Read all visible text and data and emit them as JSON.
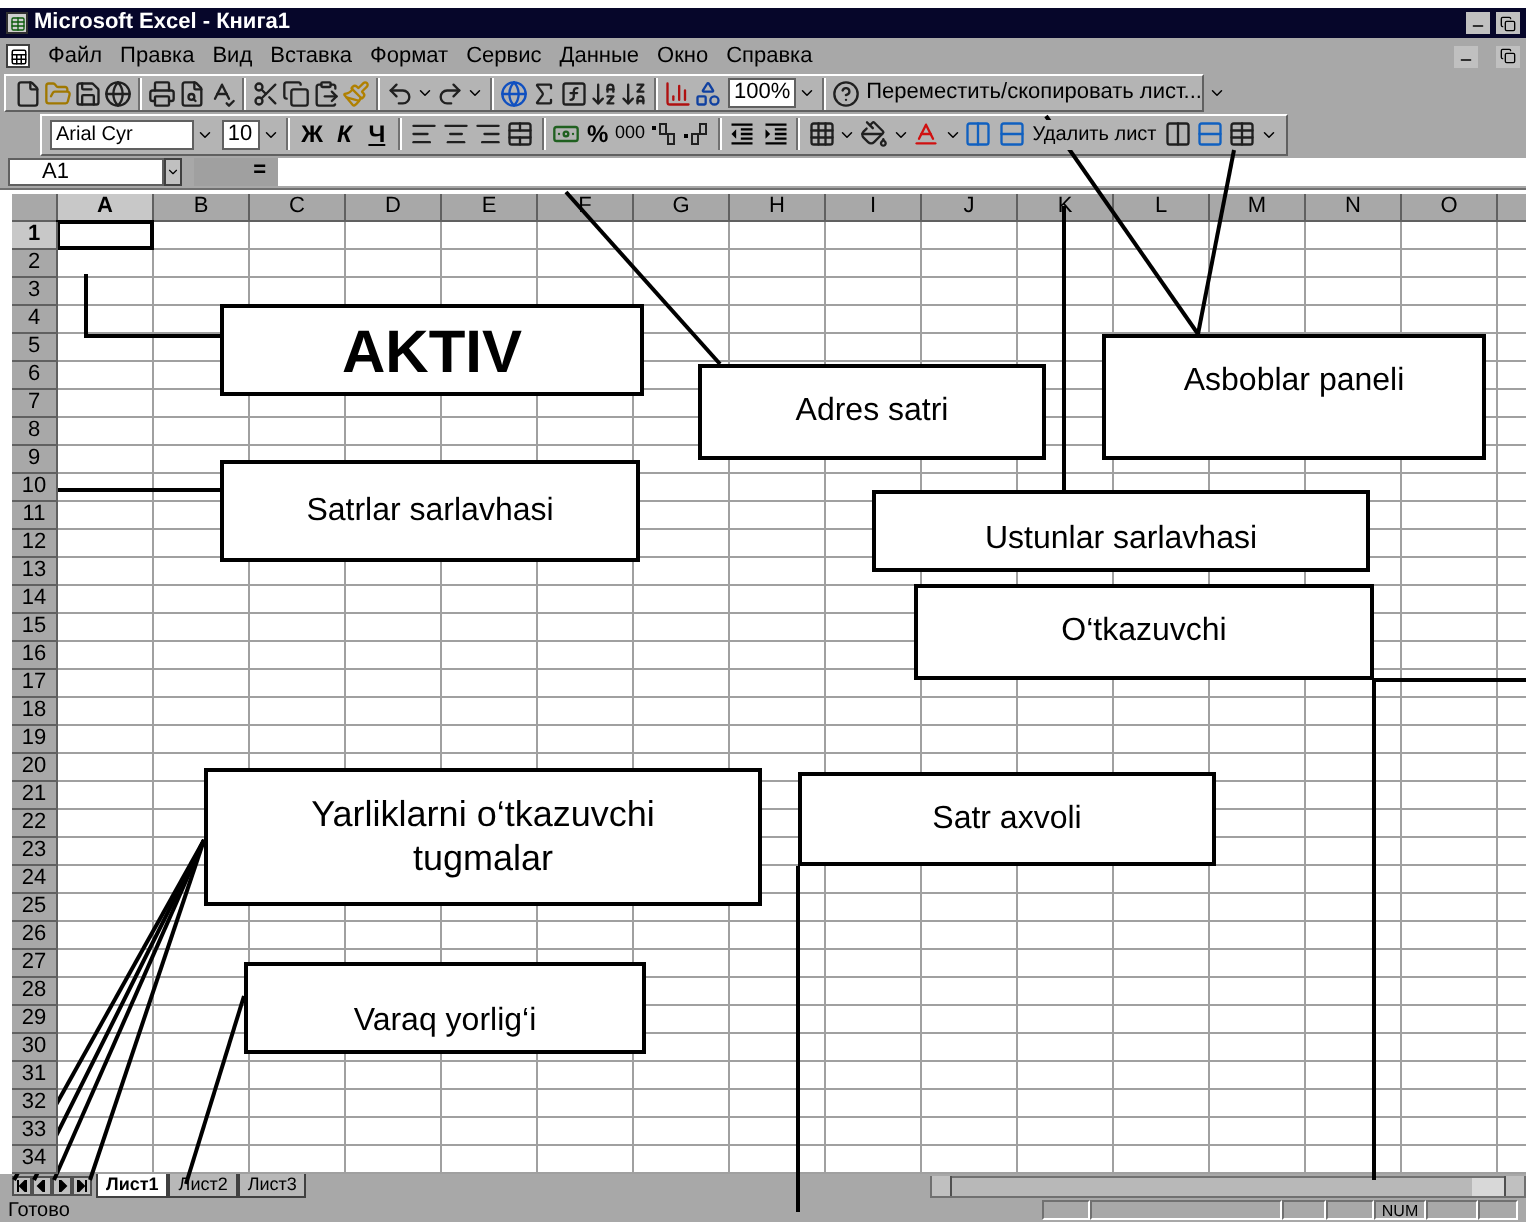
{
  "window": {
    "title": "Microsoft Excel - Книга1"
  },
  "menu": [
    "Файл",
    "Правка",
    "Вид",
    "Вставка",
    "Формат",
    "Сервис",
    "Данные",
    "Окно",
    "Справка"
  ],
  "standard_toolbar": {
    "zoom": "100%",
    "command": "Переместить/скопировать лист..."
  },
  "formatting_toolbar": {
    "font": "Arial Cyr",
    "size": "10",
    "styles": [
      "Ж",
      "К",
      "Ч"
    ],
    "percent": "%",
    "thousands": "000",
    "command": "Удалить лист"
  },
  "formula_bar": {
    "name_box": "A1",
    "equals": "="
  },
  "sheet": {
    "columns": [
      {
        "label": "A",
        "selected": true
      },
      {
        "label": "B",
        "selected": false
      },
      {
        "label": "C",
        "selected": false
      },
      {
        "label": "D",
        "selected": false
      },
      {
        "label": "E",
        "selected": false
      },
      {
        "label": "F",
        "selected": false
      },
      {
        "label": "G",
        "selected": false
      },
      {
        "label": "H",
        "selected": false
      },
      {
        "label": "I",
        "selected": false
      },
      {
        "label": "J",
        "selected": false
      },
      {
        "label": "K",
        "selected": false
      },
      {
        "label": "L",
        "selected": false
      },
      {
        "label": "M",
        "selected": false
      },
      {
        "label": "N",
        "selected": false
      },
      {
        "label": "O",
        "selected": false
      }
    ],
    "rows": [
      {
        "label": "1",
        "selected": true
      },
      {
        "label": "2",
        "selected": false
      },
      {
        "label": "3",
        "selected": false
      },
      {
        "label": "4",
        "selected": false
      },
      {
        "label": "5",
        "selected": false
      },
      {
        "label": "6",
        "selected": false
      },
      {
        "label": "7",
        "selected": false
      },
      {
        "label": "8",
        "selected": false
      },
      {
        "label": "9",
        "selected": false
      },
      {
        "label": "10",
        "selected": false
      },
      {
        "label": "11",
        "selected": false
      },
      {
        "label": "12",
        "selected": false
      },
      {
        "label": "13",
        "selected": false
      },
      {
        "label": "14",
        "selected": false
      },
      {
        "label": "15",
        "selected": false
      },
      {
        "label": "16",
        "selected": false
      },
      {
        "label": "17",
        "selected": false
      },
      {
        "label": "18",
        "selected": false
      },
      {
        "label": "19",
        "selected": false
      },
      {
        "label": "20",
        "selected": false
      },
      {
        "label": "21",
        "selected": false
      },
      {
        "label": "22",
        "selected": false
      },
      {
        "label": "23",
        "selected": false
      },
      {
        "label": "24",
        "selected": false
      },
      {
        "label": "25",
        "selected": false
      },
      {
        "label": "26",
        "selected": false
      },
      {
        "label": "27",
        "selected": false
      },
      {
        "label": "28",
        "selected": false
      },
      {
        "label": "29",
        "selected": false
      },
      {
        "label": "30",
        "selected": false
      },
      {
        "label": "31",
        "selected": false
      },
      {
        "label": "32",
        "selected": false
      },
      {
        "label": "33",
        "selected": false
      },
      {
        "label": "34",
        "selected": false
      }
    ]
  },
  "sheet_tabs": [
    {
      "label": "Лист1",
      "selected": true
    },
    {
      "label": "Лист2",
      "selected": false
    },
    {
      "label": "Лист3",
      "selected": false
    }
  ],
  "status_bar": {
    "text": "Готово",
    "indicator": "NUM"
  },
  "callouts": [
    {
      "text": "AKTIV"
    },
    {
      "text": "Adres satri"
    },
    {
      "text": "Asboblar paneli"
    },
    {
      "text": "Satrlar sarlavhasi"
    },
    {
      "text": "Ustunlar sarlavhasi"
    },
    {
      "text": "O‘tkazuvchi"
    },
    {
      "text": "Yarliklarni o‘tkazuvchi tugmalar"
    },
    {
      "text": "Satr axvoli"
    },
    {
      "text": "Varaq yorlig‘i"
    }
  ]
}
